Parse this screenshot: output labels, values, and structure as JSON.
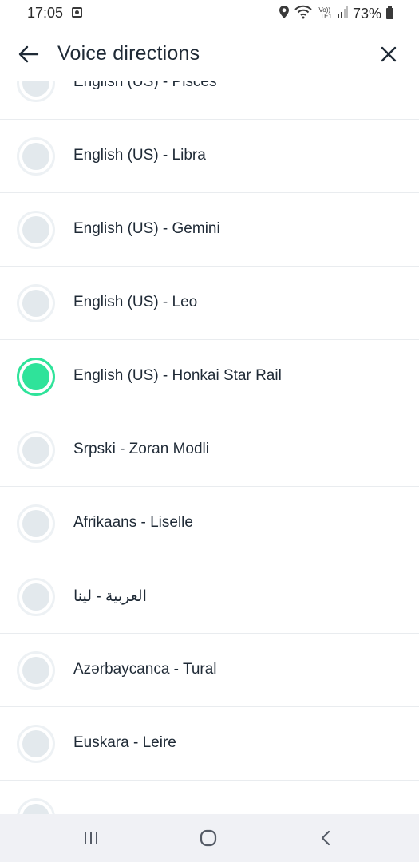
{
  "status_bar": {
    "time": "17:05",
    "volte_top": "Vo))",
    "volte_bottom": "LTE1",
    "battery": "73%"
  },
  "header": {
    "title": "Voice directions",
    "back_icon": "arrow-left-icon",
    "close_icon": "close-icon"
  },
  "colors": {
    "accent": "#2fe39a",
    "radio_inactive": "#e3e9ed",
    "divider": "#e9ecef"
  },
  "voices": [
    {
      "label": "English (US) - Pisces",
      "selected": false
    },
    {
      "label": "English (US) - Libra",
      "selected": false
    },
    {
      "label": "English (US) - Gemini",
      "selected": false
    },
    {
      "label": "English (US) - Leo",
      "selected": false
    },
    {
      "label": "English (US) - Honkai Star Rail",
      "selected": true
    },
    {
      "label": "Srpski - Zoran Modli",
      "selected": false
    },
    {
      "label": "Afrikaans - Liselle",
      "selected": false
    },
    {
      "label": "العربية - لينا",
      "selected": false
    },
    {
      "label": "Azərbaycanca - Tural",
      "selected": false
    },
    {
      "label": "Euskara - Leire",
      "selected": false
    },
    {
      "label": "",
      "selected": false
    }
  ],
  "nav_bar": {
    "recents_icon": "recents-icon",
    "home_icon": "home-icon",
    "back_icon": "nav-back-icon"
  }
}
